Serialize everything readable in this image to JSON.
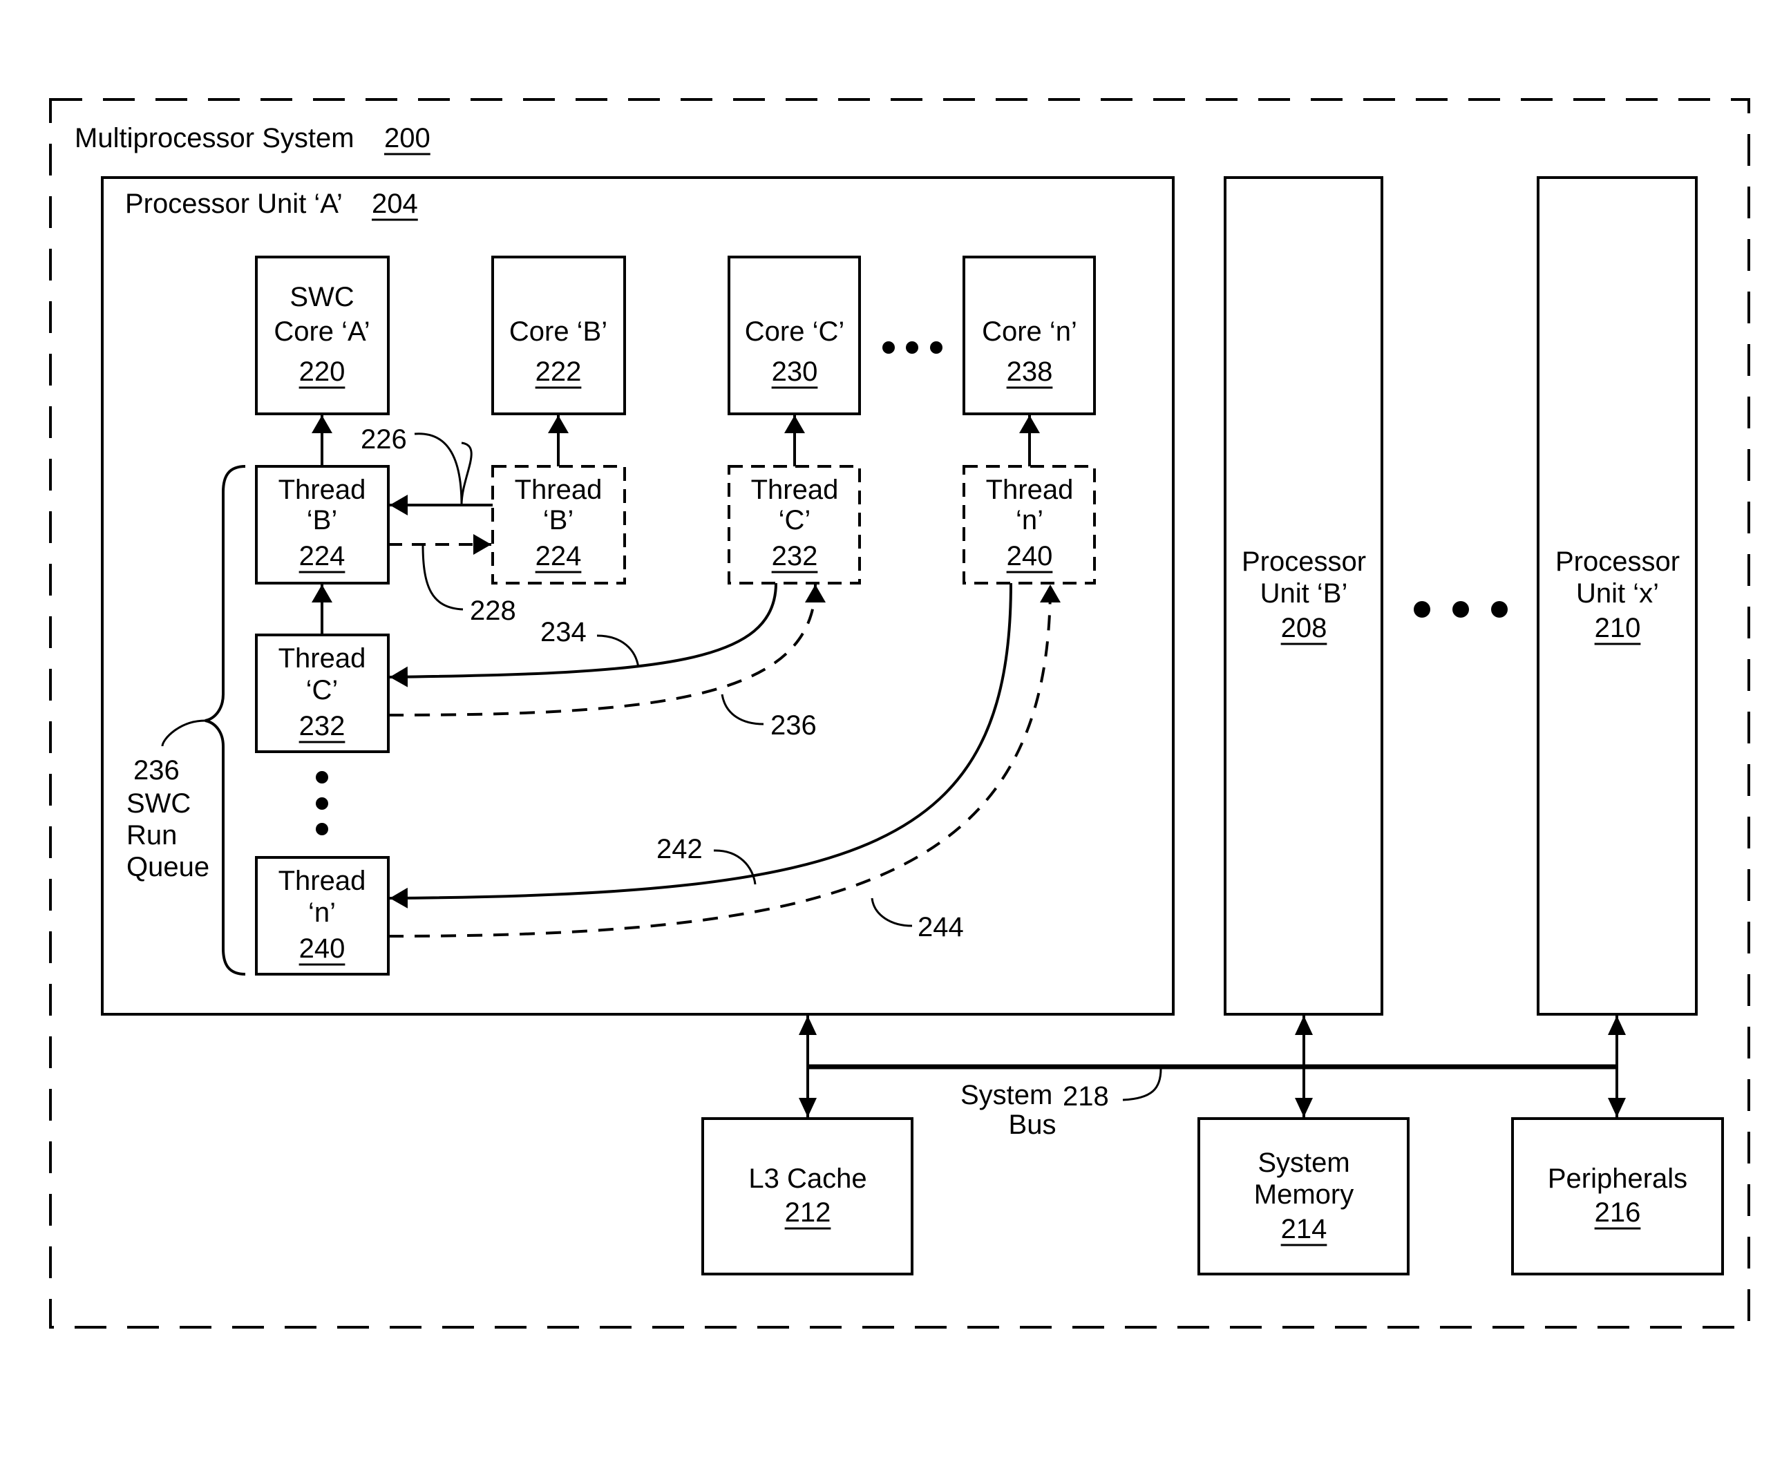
{
  "system": {
    "label": "Multiprocessor System",
    "ref": "200"
  },
  "processor_unit_a": {
    "label": "Processor Unit ‘A’",
    "ref": "204"
  },
  "cores": [
    {
      "line1": "SWC",
      "line2": "Core ‘A’",
      "ref": "220"
    },
    {
      "line1": "",
      "line2": "Core ‘B’",
      "ref": "222"
    },
    {
      "line1": "",
      "line2": "Core ‘C’",
      "ref": "230"
    },
    {
      "line1": "",
      "line2": "Core ‘n’",
      "ref": "238"
    }
  ],
  "dispatched_threads": [
    {
      "line1": "Thread",
      "line2": "‘B’",
      "ref": "224"
    },
    {
      "line1": "Thread",
      "line2": "‘C’",
      "ref": "232"
    },
    {
      "line1": "Thread",
      "line2": "‘n’",
      "ref": "240"
    }
  ],
  "run_queue_threads": [
    {
      "line1": "Thread",
      "line2": "‘B’",
      "ref": "224"
    },
    {
      "line1": "Thread",
      "line2": "‘C’",
      "ref": "232"
    },
    {
      "line1": "Thread",
      "line2": "‘n’",
      "ref": "240"
    }
  ],
  "run_queue": {
    "ref": "236",
    "line1": "SWC",
    "line2": "Run",
    "line3": "Queue"
  },
  "callouts": {
    "c226": "226",
    "c228": "228",
    "c234": "234",
    "c236": "236",
    "c242": "242",
    "c244": "244"
  },
  "other_units": [
    {
      "line1": "Processor",
      "line2": "Unit ‘B’",
      "ref": "208"
    },
    {
      "line1": "Processor",
      "line2": "Unit ‘x’",
      "ref": "210"
    }
  ],
  "bus": {
    "line1": "System",
    "ref": "218",
    "line2": "Bus"
  },
  "peripherals_row": [
    {
      "line1": "L3 Cache",
      "line2": "",
      "ref": "212"
    },
    {
      "line1": "System",
      "line2": "Memory",
      "ref": "214"
    },
    {
      "line1": "Peripherals",
      "line2": "",
      "ref": "216"
    }
  ]
}
